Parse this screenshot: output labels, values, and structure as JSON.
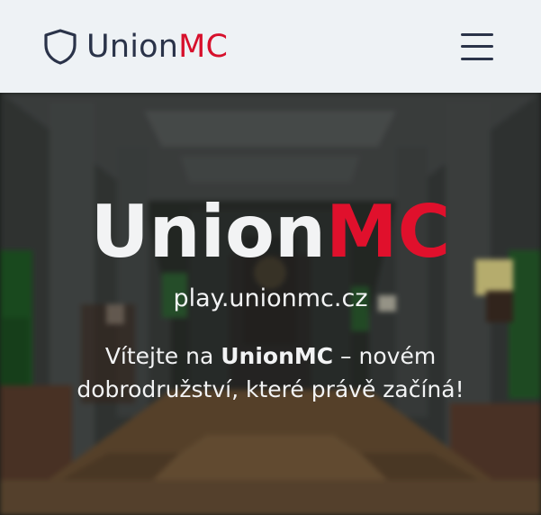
{
  "navbar": {
    "logo_icon": "shield-icon",
    "brand_primary": "Union",
    "brand_accent": "MC",
    "menu_icon": "hamburger-menu-icon"
  },
  "hero": {
    "title_primary": "Union",
    "title_accent": "MC",
    "server_ip": "play.unionmc.cz",
    "welcome_prefix": "Vítejte na ",
    "welcome_brand": "UnionMC",
    "welcome_suffix": " – novém dobrodružství, které právě začíná!"
  },
  "colors": {
    "navbar_bg": "#eef2f5",
    "brand_dark": "#2a3349",
    "accent_red": "#d7102c",
    "hero_text": "#f2f3f4"
  }
}
